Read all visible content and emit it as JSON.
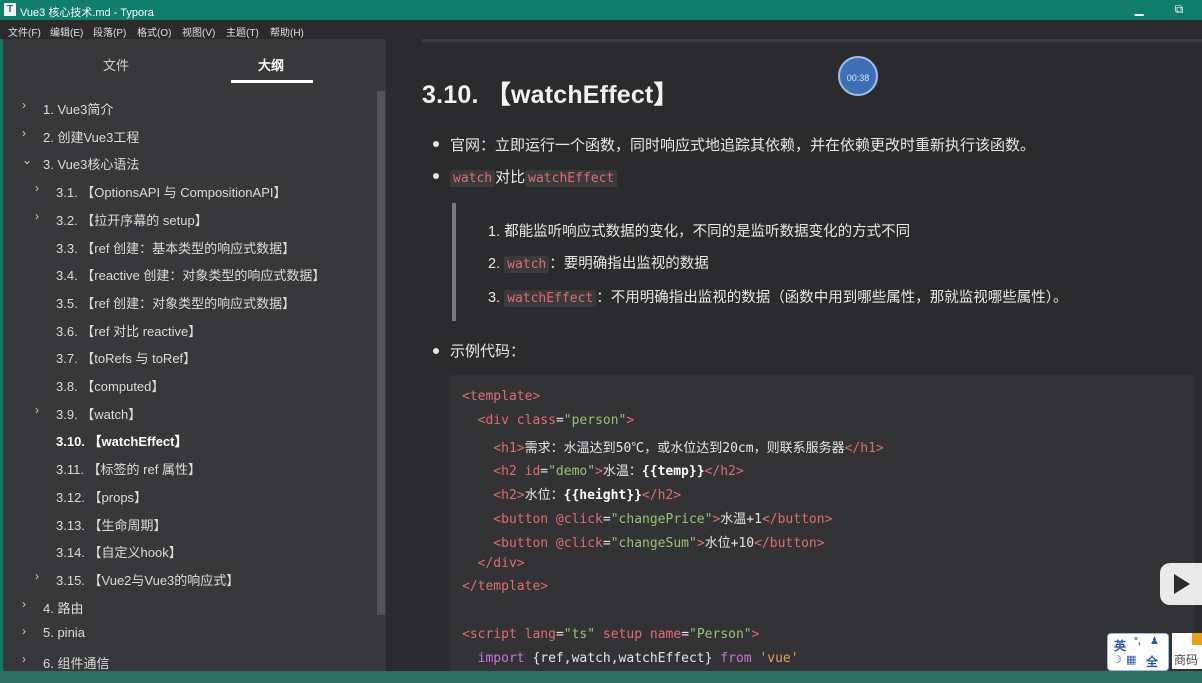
{
  "window": {
    "title": "Vue3 核心技术.md - Typora",
    "app_icon": "T",
    "minimize": "▁",
    "restore": "⧉"
  },
  "menu": [
    "文件(F)",
    "编辑(E)",
    "段落(P)",
    "格式(O)",
    "视图(V)",
    "主题(T)",
    "帮助(H)"
  ],
  "sidebar": {
    "tabs": [
      {
        "label": "文件",
        "active": false
      },
      {
        "label": "大纲",
        "active": true
      }
    ],
    "outline": [
      {
        "label": "1. Vue3简介",
        "level": 0,
        "chevron": "›"
      },
      {
        "label": "2. 创建Vue3工程",
        "level": 0,
        "chevron": "›"
      },
      {
        "label": "3. Vue3核心语法",
        "level": 0,
        "chevron": "⌄"
      },
      {
        "label": "3.1. 【OptionsAPI 与 CompositionAPI】",
        "level": 1,
        "chevron": "›"
      },
      {
        "label": "3.2. 【拉开序幕的 setup】",
        "level": 1,
        "chevron": "›"
      },
      {
        "label": "3.3. 【ref 创建：基本类型的响应式数据】",
        "level": 1,
        "chevron": ""
      },
      {
        "label": "3.4. 【reactive 创建：对象类型的响应式数据】",
        "level": 1,
        "chevron": ""
      },
      {
        "label": "3.5. 【ref 创建：对象类型的响应式数据】",
        "level": 1,
        "chevron": ""
      },
      {
        "label": "3.6. 【ref 对比 reactive】",
        "level": 1,
        "chevron": ""
      },
      {
        "label": "3.7. 【toRefs 与 toRef】",
        "level": 1,
        "chevron": ""
      },
      {
        "label": "3.8. 【computed】",
        "level": 1,
        "chevron": ""
      },
      {
        "label": "3.9. 【watch】",
        "level": 1,
        "chevron": "›"
      },
      {
        "label": "3.10. 【watchEffect】",
        "level": 1,
        "chevron": "",
        "active": true
      },
      {
        "label": "3.11. 【标签的 ref 属性】",
        "level": 1,
        "chevron": ""
      },
      {
        "label": "3.12. 【props】",
        "level": 1,
        "chevron": ""
      },
      {
        "label": "3.13. 【生命周期】",
        "level": 1,
        "chevron": ""
      },
      {
        "label": "3.14. 【自定义hook】",
        "level": 1,
        "chevron": ""
      },
      {
        "label": "3.15. 【Vue2与Vue3的响应式】",
        "level": 1,
        "chevron": "›"
      },
      {
        "label": "4. 路由",
        "level": 0,
        "chevron": "›"
      },
      {
        "label": "5. pinia",
        "level": 0,
        "chevron": "›"
      },
      {
        "label": "6. 组件通信",
        "level": 0,
        "chevron": "›"
      }
    ]
  },
  "document": {
    "heading": "3.10. 【watchEffect】",
    "bullet1": "官网：立即运行一个函数，同时响应式地追踪其依赖，并在依赖更改时重新执行该函数。",
    "bullet2": {
      "code_a": "watch",
      "text": "对比",
      "code_b": "watchEffect"
    },
    "quote": [
      {
        "prefix": "1. ",
        "code": "",
        "text": "都能监听响应式数据的变化，不同的是监听数据变化的方式不同"
      },
      {
        "prefix": "2. ",
        "code": "watch",
        "text": "：要明确指出监视的数据"
      },
      {
        "prefix": "3. ",
        "code": "watchEffect",
        "text": "：不用明确指出监视的数据（函数中用到哪些属性，那就监视哪些属性）。"
      }
    ],
    "bullet3": "示例代码：",
    "code": [
      [
        {
          "t": "<template>",
          "c": "tag"
        }
      ],
      [
        {
          "t": "  <div ",
          "c": "tag"
        },
        {
          "t": "class",
          "c": "attr"
        },
        {
          "t": "=",
          "c": "text"
        },
        {
          "t": "\"person\"",
          "c": "str"
        },
        {
          "t": ">",
          "c": "tag"
        }
      ],
      [
        {
          "t": "    <h1>",
          "c": "tag"
        },
        {
          "t": "需求：水温达到50℃，或水位达到20cm，则联系服务器",
          "c": "text"
        },
        {
          "t": "</h1>",
          "c": "tag"
        }
      ],
      [
        {
          "t": "    <h2 ",
          "c": "tag"
        },
        {
          "t": "id",
          "c": "attr"
        },
        {
          "t": "=",
          "c": "text"
        },
        {
          "t": "\"demo\"",
          "c": "str"
        },
        {
          "t": ">",
          "c": "tag"
        },
        {
          "t": "水温：",
          "c": "text"
        },
        {
          "t": "{{temp}}",
          "c": "bold"
        },
        {
          "t": "</h2>",
          "c": "tag"
        }
      ],
      [
        {
          "t": "    <h2>",
          "c": "tag"
        },
        {
          "t": "水位：",
          "c": "text"
        },
        {
          "t": "{{height}}",
          "c": "bold"
        },
        {
          "t": "</h2>",
          "c": "tag"
        }
      ],
      [
        {
          "t": "    <button ",
          "c": "tag"
        },
        {
          "t": "@click",
          "c": "attr"
        },
        {
          "t": "=",
          "c": "text"
        },
        {
          "t": "\"changePrice\"",
          "c": "str"
        },
        {
          "t": ">",
          "c": "tag"
        },
        {
          "t": "水温+1",
          "c": "text"
        },
        {
          "t": "</button>",
          "c": "tag"
        }
      ],
      [
        {
          "t": "    <button ",
          "c": "tag"
        },
        {
          "t": "@click",
          "c": "attr"
        },
        {
          "t": "=",
          "c": "text"
        },
        {
          "t": "\"changeSum\"",
          "c": "str"
        },
        {
          "t": ">",
          "c": "tag"
        },
        {
          "t": "水位+10",
          "c": "text"
        },
        {
          "t": "</button>",
          "c": "tag"
        }
      ],
      [
        {
          "t": "  </div>",
          "c": "tag"
        }
      ],
      [
        {
          "t": "</template>",
          "c": "tag"
        }
      ],
      [
        {
          "t": "",
          "c": "text"
        }
      ],
      [
        {
          "t": "<script ",
          "c": "tag"
        },
        {
          "t": "lang",
          "c": "attr"
        },
        {
          "t": "=",
          "c": "text"
        },
        {
          "t": "\"ts\"",
          "c": "str"
        },
        {
          "t": " ",
          "c": "text"
        },
        {
          "t": "setup",
          "c": "attr"
        },
        {
          "t": " ",
          "c": "text"
        },
        {
          "t": "name",
          "c": "attr"
        },
        {
          "t": "=",
          "c": "text"
        },
        {
          "t": "\"Person\"",
          "c": "str"
        },
        {
          "t": ">",
          "c": "tag"
        }
      ],
      [
        {
          "t": "  ",
          "c": "text"
        },
        {
          "t": "import",
          "c": "kw"
        },
        {
          "t": " {ref,watch,watchEffect} ",
          "c": "text"
        },
        {
          "t": "from",
          "c": "kw"
        },
        {
          "t": " ",
          "c": "text"
        },
        {
          "t": "'vue'",
          "c": "strq"
        }
      ]
    ]
  },
  "overlay": {
    "timer": "00:38",
    "ime": {
      "lang": "英",
      "mode": "全"
    },
    "ime_side_text": "商码"
  },
  "colors": {
    "titlebar": "#107e6a",
    "sidebar": "#38383b",
    "editor": "#2b2b2d",
    "code_bg": "#333336",
    "inline_code": "#e06c75"
  }
}
